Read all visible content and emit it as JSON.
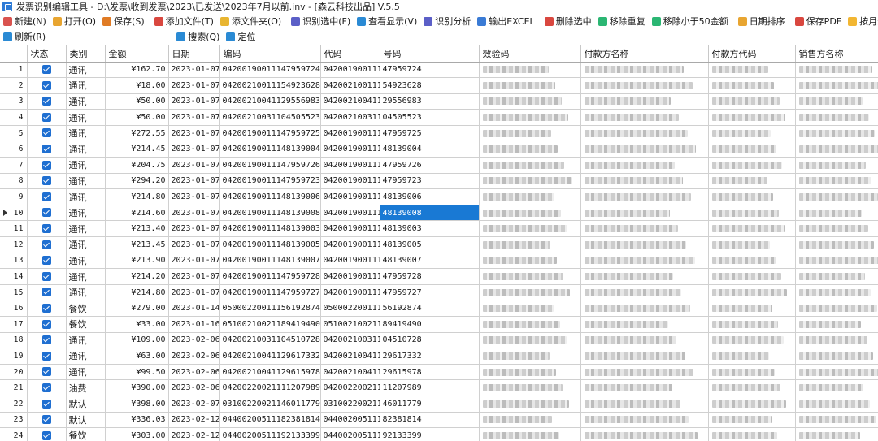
{
  "window": {
    "title": "发票识别编辑工具 - D:\\发票\\收到发票\\2023\\已发送\\2023年7月以前.inv - [森云科技出品] V.5.5"
  },
  "toolbar": [
    {
      "label": "新建(N)",
      "icon": "new-icon",
      "color": "#d9534f"
    },
    {
      "label": "打开(O)",
      "icon": "open-folder-icon",
      "color": "#e8a531"
    },
    {
      "label": "保存(S)",
      "icon": "save-icon",
      "color": "#e07b24"
    },
    {
      "label": "添加文件(T)",
      "icon": "add-file-icon",
      "color": "#d9473f"
    },
    {
      "label": "添文件夹(O)",
      "icon": "add-folder-icon",
      "color": "#e8b531"
    },
    {
      "label": "识别选中(F)",
      "icon": "recognize-icon",
      "color": "#5b5fc7"
    },
    {
      "label": "查看显示(V)",
      "icon": "view-icon",
      "color": "#2a8ad4"
    },
    {
      "label": "识别分析",
      "icon": "analyze-icon",
      "color": "#5b5fc7"
    },
    {
      "label": "输出EXCEL",
      "icon": "excel-icon",
      "color": "#3a7bd5"
    },
    {
      "label": "删除选中",
      "icon": "delete-icon",
      "color": "#d9473f"
    },
    {
      "label": "移除重复",
      "icon": "remove-duplicate-icon",
      "color": "#2bb673"
    },
    {
      "label": "移除小于50金额",
      "icon": "remove-small-icon",
      "color": "#2bb673"
    },
    {
      "label": "日期排序",
      "icon": "sort-date-icon",
      "color": "#e8a531"
    },
    {
      "label": "保存PDF",
      "icon": "pdf-icon",
      "color": "#d9473f"
    },
    {
      "label": "按月分多",
      "icon": "split-month-icon",
      "color": "#f2b632"
    }
  ],
  "toolbar2": [
    {
      "label": "刷新(R)",
      "icon": "refresh-icon",
      "color": "#2a8ad4"
    },
    {
      "label": "搜索(Q)",
      "icon": "search-icon",
      "color": "#2a8ad4"
    },
    {
      "label": "定位",
      "icon": "locate-icon",
      "color": "#2a8ad4"
    }
  ],
  "columns": [
    "",
    "状态",
    "类别",
    "金额",
    "日期",
    "编码",
    "代码",
    "号码",
    "效验码",
    "付款方名称",
    "付款方代码",
    "销售方名称"
  ],
  "selected_row": 10,
  "rows": [
    {
      "n": "1",
      "cat": "通讯",
      "amt": "¥162.70",
      "date": "2023-01-07",
      "code": "04200190011147959724",
      "dm": "042001900111",
      "hm": "47959724"
    },
    {
      "n": "2",
      "cat": "通讯",
      "amt": "¥18.00",
      "date": "2023-01-07",
      "code": "04200210011154923628",
      "dm": "042002100111",
      "hm": "54923628"
    },
    {
      "n": "3",
      "cat": "通讯",
      "amt": "¥50.00",
      "date": "2023-01-07",
      "code": "04200210041129556983",
      "dm": "042002100411",
      "hm": "29556983"
    },
    {
      "n": "4",
      "cat": "通讯",
      "amt": "¥50.00",
      "date": "2023-01-07",
      "code": "04200210031104505523",
      "dm": "042002100311",
      "hm": "04505523"
    },
    {
      "n": "5",
      "cat": "通讯",
      "amt": "¥272.55",
      "date": "2023-01-07",
      "code": "04200190011147959725",
      "dm": "042001900111",
      "hm": "47959725"
    },
    {
      "n": "6",
      "cat": "通讯",
      "amt": "¥214.45",
      "date": "2023-01-07",
      "code": "04200190011148139004",
      "dm": "042001900111",
      "hm": "48139004"
    },
    {
      "n": "7",
      "cat": "通讯",
      "amt": "¥204.75",
      "date": "2023-01-07",
      "code": "04200190011147959726",
      "dm": "042001900111",
      "hm": "47959726"
    },
    {
      "n": "8",
      "cat": "通讯",
      "amt": "¥294.20",
      "date": "2023-01-07",
      "code": "04200190011147959723",
      "dm": "042001900111",
      "hm": "47959723"
    },
    {
      "n": "9",
      "cat": "通讯",
      "amt": "¥214.80",
      "date": "2023-01-07",
      "code": "04200190011148139006",
      "dm": "042001900111",
      "hm": "48139006"
    },
    {
      "n": "10",
      "cat": "通讯",
      "amt": "¥214.60",
      "date": "2023-01-07",
      "code": "04200190011148139008",
      "dm": "042001900111",
      "hm": "48139008"
    },
    {
      "n": "11",
      "cat": "通讯",
      "amt": "¥213.40",
      "date": "2023-01-07",
      "code": "04200190011148139003",
      "dm": "042001900111",
      "hm": "48139003"
    },
    {
      "n": "12",
      "cat": "通讯",
      "amt": "¥213.45",
      "date": "2023-01-07",
      "code": "04200190011148139005",
      "dm": "042001900111",
      "hm": "48139005"
    },
    {
      "n": "13",
      "cat": "通讯",
      "amt": "¥213.90",
      "date": "2023-01-07",
      "code": "04200190011148139007",
      "dm": "042001900111",
      "hm": "48139007"
    },
    {
      "n": "14",
      "cat": "通讯",
      "amt": "¥214.20",
      "date": "2023-01-07",
      "code": "04200190011147959728",
      "dm": "042001900111",
      "hm": "47959728"
    },
    {
      "n": "15",
      "cat": "通讯",
      "amt": "¥214.80",
      "date": "2023-01-07",
      "code": "04200190011147959727",
      "dm": "042001900111",
      "hm": "47959727"
    },
    {
      "n": "16",
      "cat": "餐饮",
      "amt": "¥279.00",
      "date": "2023-01-14",
      "code": "05000220011156192874",
      "dm": "050002200111",
      "hm": "56192874"
    },
    {
      "n": "17",
      "cat": "餐饮",
      "amt": "¥33.00",
      "date": "2023-01-16",
      "code": "05100210021189419490",
      "dm": "051002100211",
      "hm": "89419490"
    },
    {
      "n": "18",
      "cat": "通讯",
      "amt": "¥109.00",
      "date": "2023-02-06",
      "code": "04200210031104510728",
      "dm": "042002100311",
      "hm": "04510728"
    },
    {
      "n": "19",
      "cat": "通讯",
      "amt": "¥63.00",
      "date": "2023-02-06",
      "code": "04200210041129617332",
      "dm": "042002100411",
      "hm": "29617332"
    },
    {
      "n": "20",
      "cat": "通讯",
      "amt": "¥99.50",
      "date": "2023-02-06",
      "code": "04200210041129615978",
      "dm": "042002100411",
      "hm": "29615978"
    },
    {
      "n": "21",
      "cat": "油费",
      "amt": "¥390.00",
      "date": "2023-02-06",
      "code": "04200220021111207989",
      "dm": "042002200211",
      "hm": "11207989"
    },
    {
      "n": "22",
      "cat": "默认",
      "amt": "¥398.00",
      "date": "2023-02-07",
      "code": "03100220021146011779",
      "dm": "031002200211",
      "hm": "46011779"
    },
    {
      "n": "23",
      "cat": "默认",
      "amt": "¥336.03",
      "date": "2023-02-12",
      "code": "04400200511182381814",
      "dm": "044002005111",
      "hm": "82381814"
    },
    {
      "n": "24",
      "cat": "餐饮",
      "amt": "¥303.00",
      "date": "2023-02-12",
      "code": "04400200511192133399",
      "dm": "044002005111",
      "hm": "92133399"
    }
  ]
}
